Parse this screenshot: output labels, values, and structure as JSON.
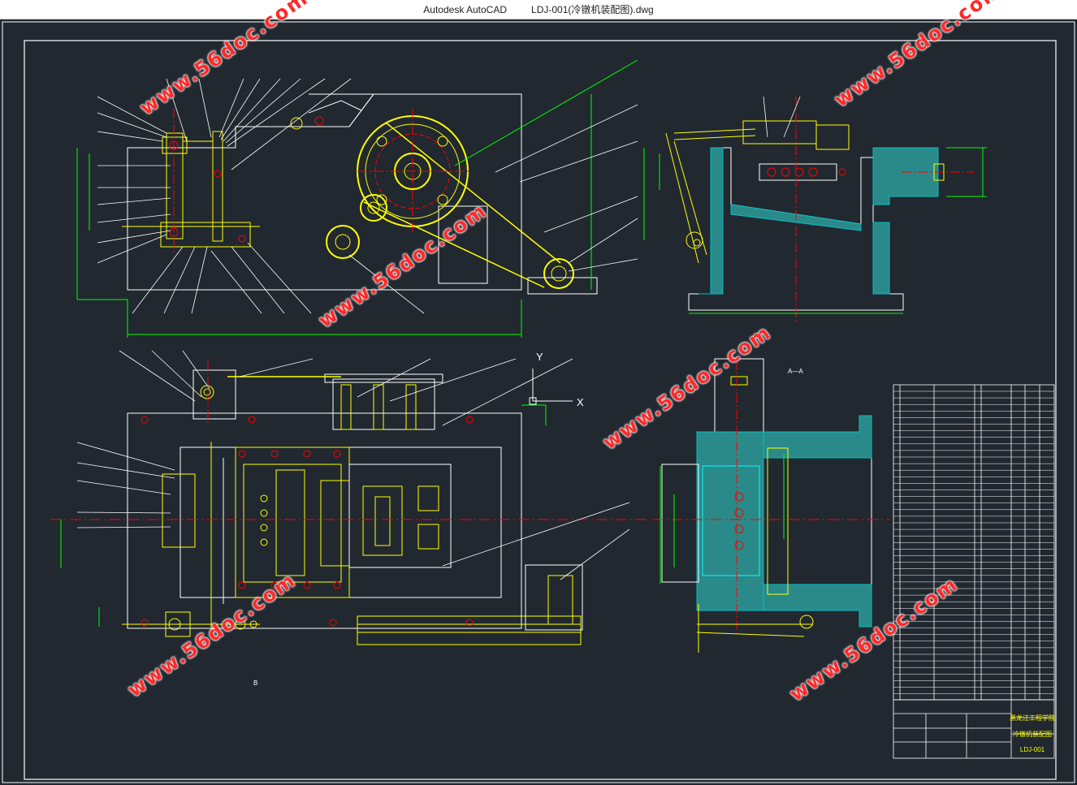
{
  "window": {
    "app_name": "Autodesk AutoCAD",
    "document_title": "LDJ-001(冷镦机装配图).dwg"
  },
  "drawing": {
    "watermark_text": "www.56doc.com",
    "section_label_top": "A—A",
    "section_label_bottom": "B",
    "axis_y_label": "Y",
    "axis_x_label": "X",
    "title_block": {
      "school": "黑龙江工程学院",
      "drawing_name": "冷镦机装配图",
      "drawing_code": "LDJ-001"
    }
  },
  "colors": {
    "background": "#212830",
    "geometry_white": "#ffffff",
    "geometry_yellow": "#ffff00",
    "dimension_green": "#00ff00",
    "center_red": "#ff0000",
    "hatch_cyan": "#00c0c0",
    "watermark_red": "#ff2a2a"
  }
}
